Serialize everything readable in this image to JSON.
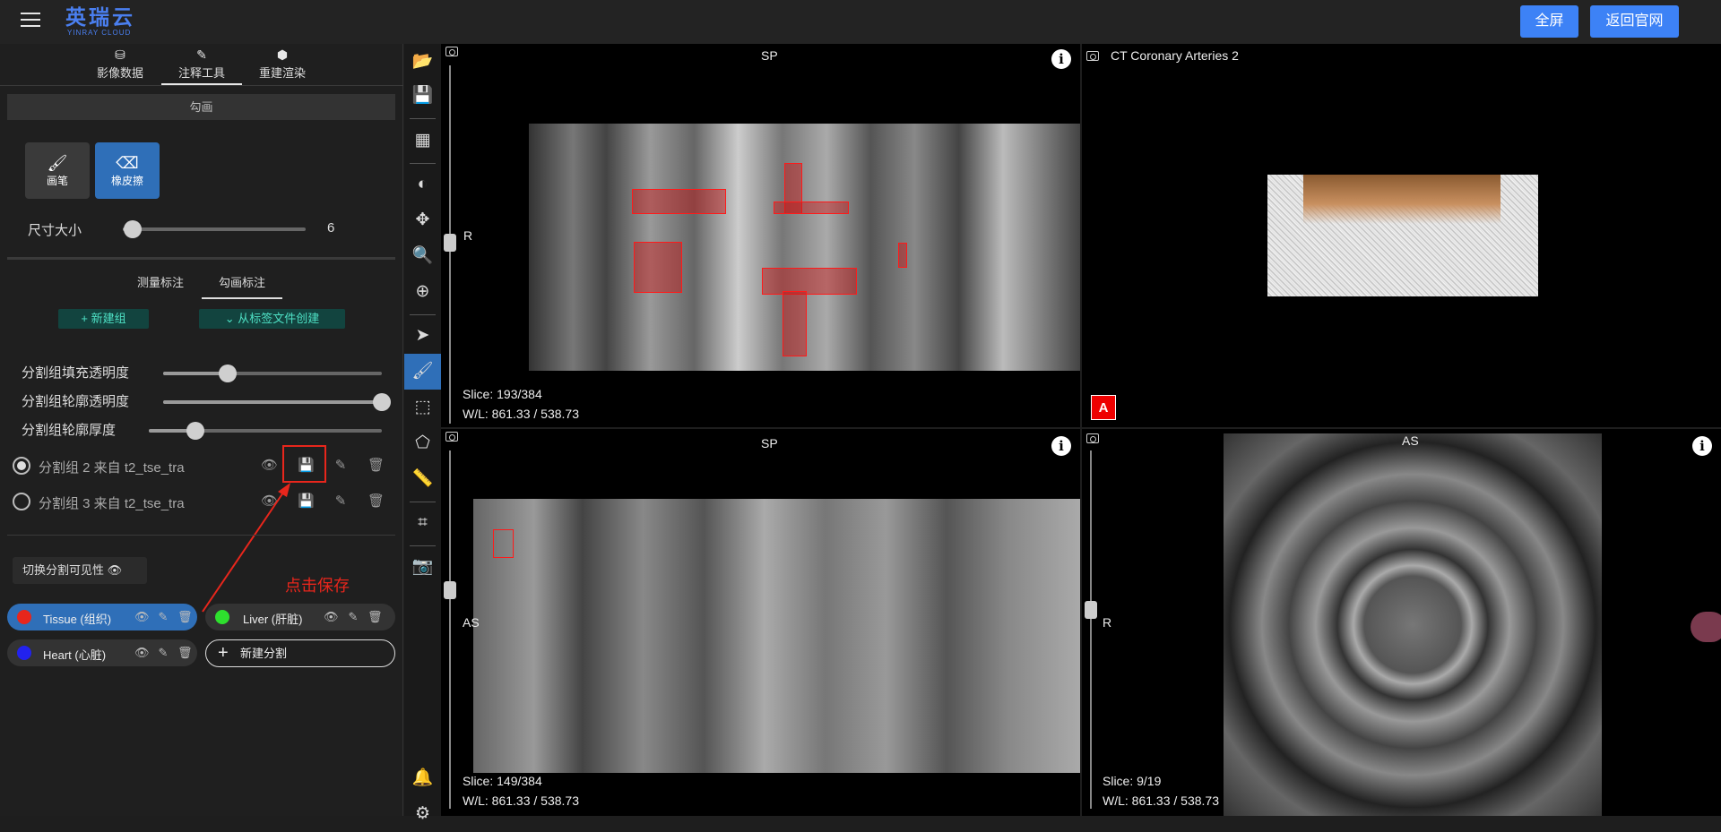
{
  "app": {
    "logo_title": "英瑞云",
    "logo_subtitle": "YINRAY CLOUD"
  },
  "header": {
    "fullscreen_label": "全屏",
    "back_label": "返回官网"
  },
  "left_tabs": [
    {
      "label": "影像数据",
      "icon": "database-icon"
    },
    {
      "label": "注释工具",
      "icon": "pencil-icon"
    },
    {
      "label": "重建渲染",
      "icon": "cube-icon"
    }
  ],
  "draw_section": {
    "title": "勾画"
  },
  "tools": [
    {
      "label": "画笔",
      "icon": "brush-icon"
    },
    {
      "label": "橡皮擦",
      "icon": "eraser-icon"
    }
  ],
  "brush_size": {
    "label": "尺寸大小",
    "value": "6",
    "fraction": 0.05
  },
  "annot_tabs": [
    {
      "label": "测量标注"
    },
    {
      "label": "勾画标注"
    }
  ],
  "actions": {
    "new_group": "+ 新建组",
    "create_from_file": "⌄ 从标签文件创建"
  },
  "opacity": {
    "fill_label": "分割组填充透明度",
    "fill_value": 0.3,
    "outline_label": "分割组轮廓透明度",
    "outline_value": 1.0,
    "thickness_label": "分割组轮廓厚度",
    "thickness_value": 0.2
  },
  "groups": [
    {
      "label": "分割组 2 来自 t2_tse_tra",
      "selected": true
    },
    {
      "label": "分割组 3 来自 t2_tse_tra",
      "selected": false
    }
  ],
  "toggle_visibility_label": "切换分割可见性",
  "annotation_note": "点击保存",
  "segments": [
    {
      "name": "Tissue (组织)",
      "color": "#e8261c",
      "active": true
    },
    {
      "name": "Liver (肝脏)",
      "color": "#2ee02e",
      "active": false
    },
    {
      "name": "Heart (心脏)",
      "color": "#2222ee",
      "active": false
    }
  ],
  "new_segment_label": "新建分割",
  "viewports": {
    "top_left": {
      "orientation_top": "SP",
      "orientation_side": "R",
      "slice": "Slice: 193/384",
      "wl": "W/L: 861.33 / 538.73"
    },
    "top_right": {
      "title": "CT Coronary Arteries 2",
      "marker": "A"
    },
    "bottom_left": {
      "orientation_top": "SP",
      "orientation_side": "AS",
      "slice": "Slice: 149/384",
      "wl": "W/L: 861.33 / 538.73"
    },
    "bottom_right": {
      "orientation_top": "AS",
      "orientation_side": "R",
      "slice": "Slice: 9/19",
      "wl": "W/L: 861.33 / 538.73"
    }
  }
}
